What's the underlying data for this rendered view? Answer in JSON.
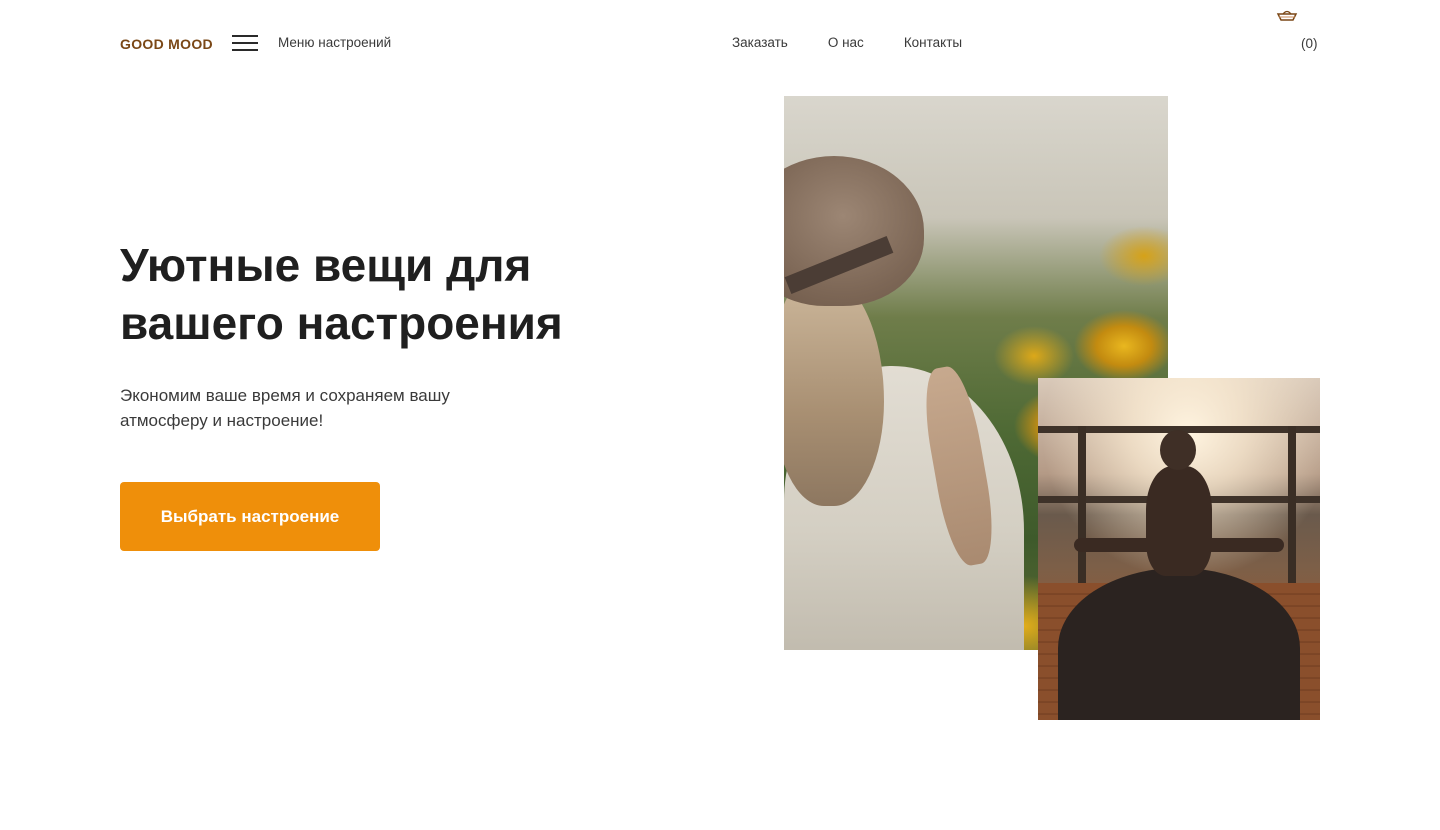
{
  "header": {
    "logo": "GOOD MOOD",
    "menu_label": "Меню настроений",
    "nav": [
      "Заказать",
      "О нас",
      "Контакты"
    ],
    "cart_count": "(0)"
  },
  "hero": {
    "title": "Уютные вещи для вашего настроения",
    "subtitle": "Экономим ваше время и сохраняем вашу атмосферу и настроение!",
    "cta_label": "Выбрать настроение"
  },
  "colors": {
    "logo": "#7a4716",
    "cta": "#ef8f0a",
    "text": "#1f1f1f"
  },
  "icons": {
    "menu": "hamburger-icon",
    "cart": "basket-icon"
  }
}
